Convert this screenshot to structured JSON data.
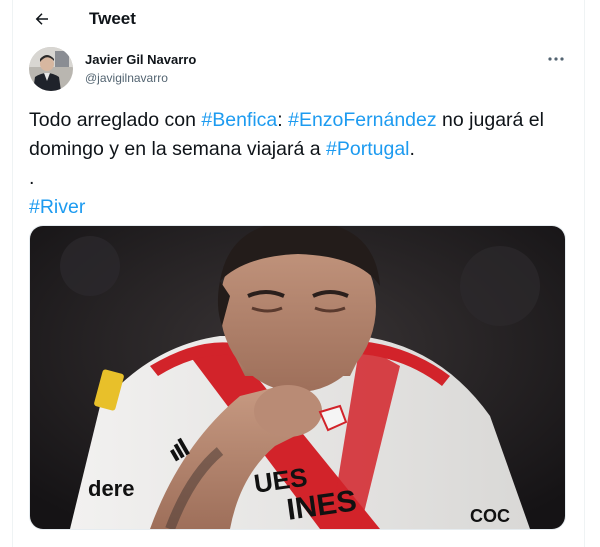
{
  "header": {
    "title": "Tweet",
    "back_icon": "arrow-left-icon"
  },
  "author": {
    "display_name": "Javier Gil Navarro",
    "handle": "@javigilnavarro",
    "more_icon": "more-horizontal-icon"
  },
  "tweet": {
    "line1_plain_a": "Todo arreglado con ",
    "hashtag_benfica": "#Benfica",
    "line1_plain_b": ": ",
    "hashtag_enzo": "#EnzoFernández",
    "line1_plain_c": " no jugará el domingo y en la semana viajará a ",
    "hashtag_portugal": "#Portugal",
    "line1_plain_d": ".",
    "dot_line": ".",
    "hashtag_river": "#River"
  },
  "media": {
    "jersey_text_1": "dere",
    "jersey_text_2": "UES",
    "jersey_text_3": "INES",
    "jersey_text_4": "COC"
  },
  "colors": {
    "link": "#1d9bf0",
    "text": "#0f1419",
    "secondary": "#536471",
    "jersey_red": "#d2232a"
  }
}
